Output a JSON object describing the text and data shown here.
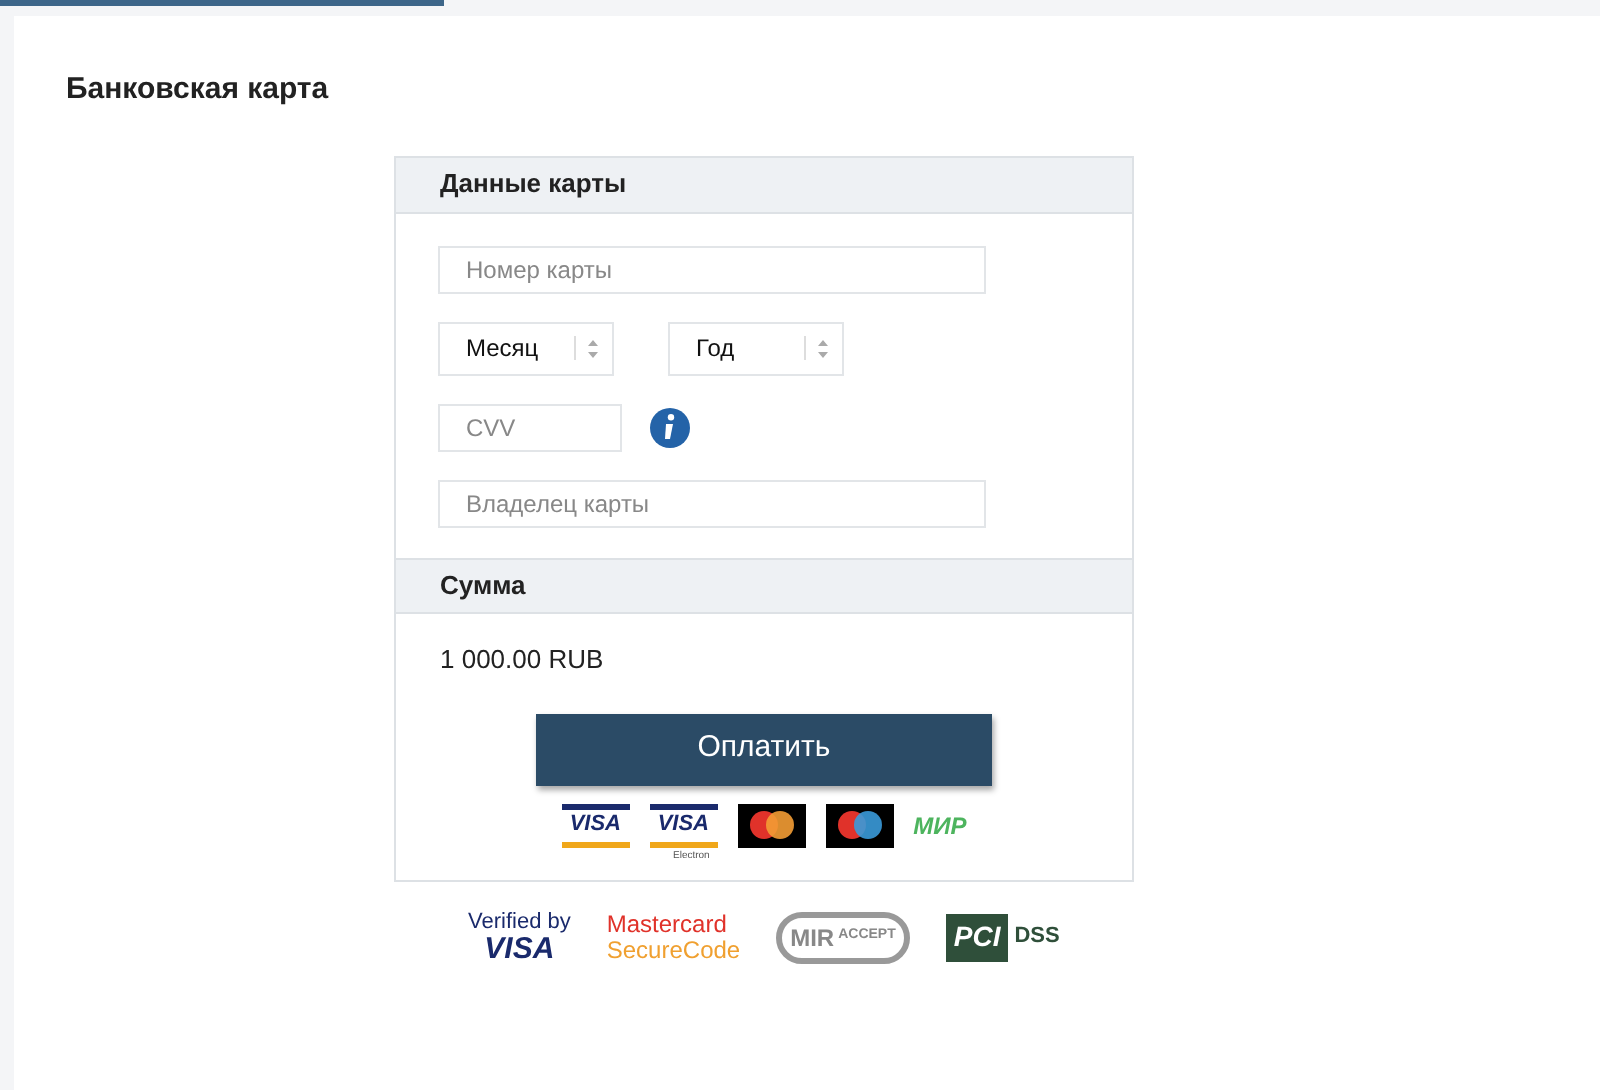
{
  "title": "Банковская карта",
  "card_section": {
    "heading": "Данные карты",
    "fields": [
      {
        "kind": "text",
        "placeholder": "Номер карты"
      },
      {
        "kind": "select_pair",
        "selects": [
          {
            "value": "Месяц"
          },
          {
            "value": "Год"
          }
        ]
      },
      {
        "kind": "cvv",
        "placeholder": "CVV"
      },
      {
        "kind": "text",
        "placeholder": "Владелец карты"
      }
    ]
  },
  "sum_section": {
    "heading": "Сумма",
    "amount": "1 000.00 RUB"
  },
  "pay_button": "Оплатить",
  "card_logos": [
    {
      "kind": "visa",
      "text": "VISA"
    },
    {
      "kind": "visa_electron",
      "text": "VISA",
      "sub": "Electron"
    },
    {
      "kind": "mastercard"
    },
    {
      "kind": "maestro"
    },
    {
      "kind": "mir",
      "text": "МИР"
    }
  ],
  "security_logos": [
    {
      "kind": "verified_visa",
      "line1": "Verified by",
      "line2": "VISA"
    },
    {
      "kind": "securecode",
      "line1": "Mastercard",
      "line2": "SecureCode"
    },
    {
      "kind": "mir_accept",
      "line1": "MIR",
      "line2": "ACCEPT"
    },
    {
      "kind": "pci",
      "line1": "PCI",
      "line2": "DSS"
    }
  ]
}
